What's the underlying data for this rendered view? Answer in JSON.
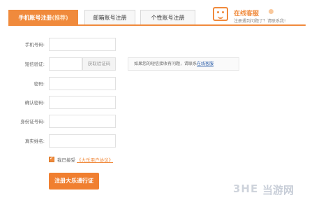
{
  "tabs": {
    "phone": {
      "label": "手机账号注册",
      "tag": "(推荐)"
    },
    "email": {
      "label": "邮箱账号注册"
    },
    "custom": {
      "label": "个性账号注册"
    }
  },
  "service": {
    "title": "在线客服",
    "subtitle": "注册遇到问题了？请联系我!"
  },
  "form": {
    "phone_label": "手机号码:",
    "sms_label": "短信验证:",
    "sms_button": "获取验证码",
    "sms_hint": "如果您的短信接收有问题，请联系",
    "sms_hint_link": "在线客服",
    "password_label": "密码:",
    "confirm_label": "确认密码:",
    "id_label": "身份证号码:",
    "name_label": "真实姓名:",
    "agree_text": "我已接受",
    "agree_link": "《大乐用户协议》",
    "submit": "注册大乐通行证"
  },
  "watermark": {
    "logo": "3HE",
    "text": "当游网"
  },
  "colors": {
    "accent": "#f08a3c",
    "link": "#2a5ca8"
  }
}
